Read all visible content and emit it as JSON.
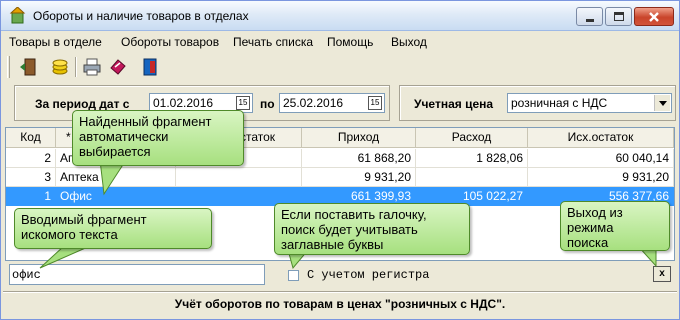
{
  "window": {
    "title": "Обороты и наличие товаров в отделах"
  },
  "menu": {
    "items": [
      "Товары в отделе",
      "Обороты товаров",
      "Печать списка",
      "Помощь",
      "Выход"
    ]
  },
  "toolbar": {
    "icons": [
      "exit-door-icon",
      "coins-icon",
      "printer-icon",
      "books-icon",
      "door-icon"
    ]
  },
  "filters": {
    "period_label": "За период дат с",
    "date_from": "01.02.2016",
    "to_label": "по",
    "date_to": "25.02.2016",
    "calendar_glyph": "15",
    "price_label": "Учетная цена",
    "price_value": "розничная с НДС"
  },
  "grid": {
    "columns": [
      "Код",
      "*",
      "статок",
      "Приход",
      "Расход",
      "Исх.остаток"
    ],
    "rows": [
      {
        "code": "2",
        "name": "Ап",
        "start": "",
        "income": "61 868,20",
        "expense": "1 828,06",
        "end": "60 040,14"
      },
      {
        "code": "3",
        "name": "Аптека 1",
        "start": "",
        "income": "9 931,20",
        "expense": "",
        "end": "9 931,20"
      },
      {
        "code": "1",
        "name": "Офис",
        "start": "",
        "income": "661 399,93",
        "expense": "105 022,27",
        "end": "556 377,66",
        "selected": true
      }
    ]
  },
  "search": {
    "value": "офис",
    "case_label": "С учетом регистра",
    "case_checked": false,
    "exit_label": "x"
  },
  "status": {
    "text": "Учёт оборотов по товарам в ценах \"розничных с НДС\"."
  },
  "callouts": {
    "found": "Найденный фрагмент\nавтоматически\nвыбирается",
    "typed": "Вводимый фрагмент\nискомого текста",
    "case": "Если поставить галочку,\nпоиск будет учитывать\nзаглавные буквы",
    "exit": "Выход из\nрежима\nпоиска"
  },
  "colors": {
    "selection": "#3399ff",
    "callout": "#a7e07f"
  }
}
